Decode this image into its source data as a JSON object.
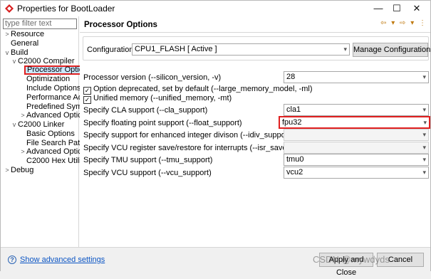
{
  "window": {
    "title": "Properties for BootLoader",
    "minimize": "—",
    "maximize": "☐",
    "close": "✕"
  },
  "left": {
    "filter_placeholder": "type filter text",
    "tree": [
      {
        "label": "Resource",
        "arrow": ">"
      },
      {
        "label": "General",
        "arrow": ""
      },
      {
        "label": "Build",
        "arrow": "v"
      },
      {
        "label": "C2000 Compiler",
        "arrow": "v"
      },
      {
        "label": "Processor Optio",
        "arrow": "",
        "selected": true
      },
      {
        "label": "Optimization",
        "arrow": ""
      },
      {
        "label": "Include Options",
        "arrow": ""
      },
      {
        "label": "Performance Ad",
        "arrow": ""
      },
      {
        "label": "Predefined Syml",
        "arrow": ""
      },
      {
        "label": "Advanced Optic",
        "arrow": ">"
      },
      {
        "label": "C2000 Linker",
        "arrow": "v"
      },
      {
        "label": "Basic Options",
        "arrow": ""
      },
      {
        "label": "File Search Path",
        "arrow": ""
      },
      {
        "label": "Advanced Optic",
        "arrow": ">"
      },
      {
        "label": "C2000 Hex Utility",
        "arrow": ""
      },
      {
        "label": "Debug",
        "arrow": ">"
      }
    ]
  },
  "right": {
    "title": "Processor Options",
    "nav_arrows": "⇦ ▾ ⇨ ▾ ⋮",
    "config": {
      "label": "Configuration:",
      "value": "CPU1_FLASH  [ Active ]",
      "manage_button": "Manage Configurations..."
    },
    "options": [
      {
        "label": "Processor version (--silicon_version, -v)",
        "type": "select",
        "value": "28"
      },
      {
        "label": "Option deprecated, set by default (--large_memory_model, -ml)",
        "type": "checkbox",
        "checked": true
      },
      {
        "label": "Unified memory (--unified_memory, -mt)",
        "type": "checkbox",
        "checked": true
      },
      {
        "label": "Specify CLA support (--cla_support)",
        "type": "select",
        "value": "cla1"
      },
      {
        "label": "Specify floating point support (--float_support)",
        "type": "select",
        "value": "fpu32",
        "highlighted": true
      },
      {
        "label": "Specify support for enhanced integer divison (--idiv_support)",
        "type": "select",
        "value": ""
      },
      {
        "label": "Specify VCU register save/restore for interrupts (--isr_save_vcu_regs)",
        "type": "select",
        "value": ""
      },
      {
        "label": "Specify TMU support (--tmu_support)",
        "type": "select",
        "value": "tmu0"
      },
      {
        "label": "Specify VCU support (--vcu_support)",
        "type": "select",
        "value": "vcu2"
      }
    ]
  },
  "footer": {
    "help_icon": "?",
    "advanced_link": "Show advanced settings",
    "apply_close": "Apply and Close",
    "cancel": "Cancel",
    "watermark": "CSDN @mywdyds"
  }
}
